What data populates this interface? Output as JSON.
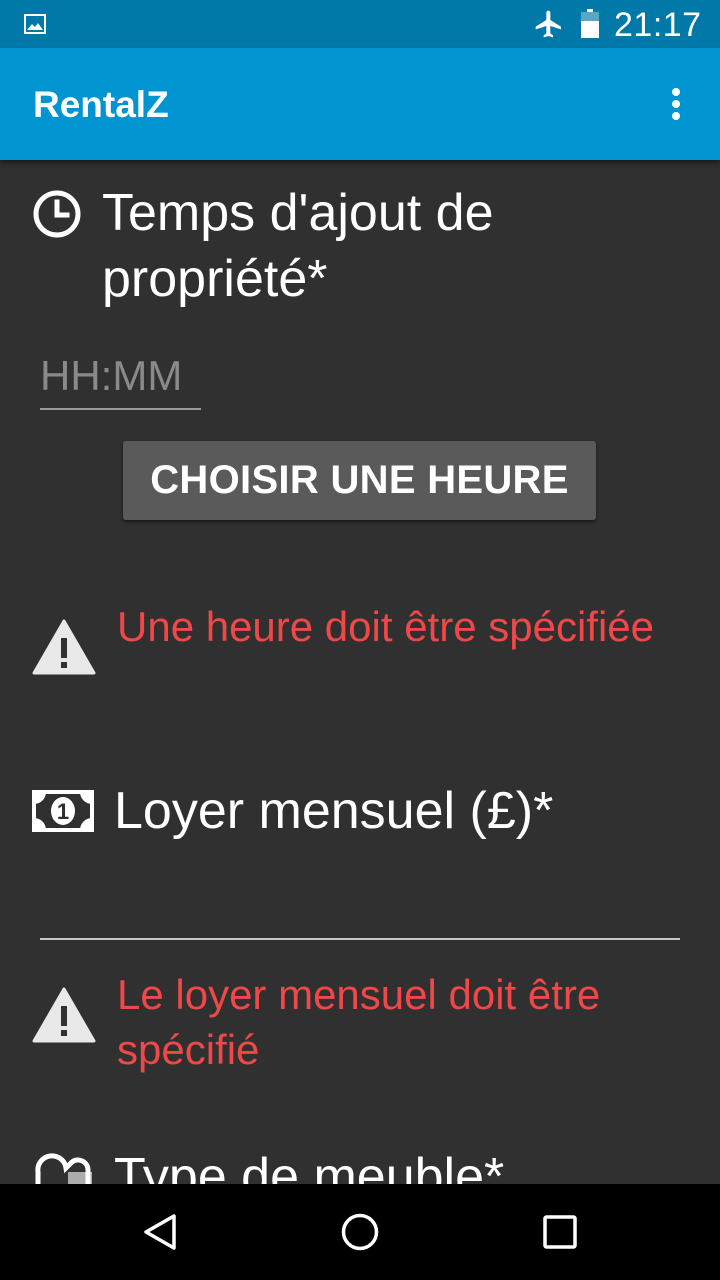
{
  "status_bar": {
    "time": "21:17",
    "icons": [
      "gallery-notification-icon",
      "airplane-mode-icon",
      "battery-icon"
    ]
  },
  "app_bar": {
    "title": "RentalZ",
    "menu_icon": "more-vert-icon"
  },
  "form": {
    "time_section": {
      "icon": "clock-icon",
      "title": "Temps d'ajout de propriété*",
      "input_placeholder": "HH:MM",
      "input_value": "",
      "button_label": "CHOISIR UNE HEURE",
      "error_icon": "warning-icon",
      "error": "Une heure doit être spécifiée"
    },
    "rent_section": {
      "icon": "money-icon",
      "title": "Loyer mensuel (£)*",
      "input_value": "",
      "error_icon": "warning-icon",
      "error": "Le loyer mensuel doit être spécifié"
    },
    "furniture_section": {
      "icon": "sofa-icon",
      "title": "Type de meuble*"
    }
  },
  "colors": {
    "status_bar": "#0079a8",
    "app_bar": "#0095d0",
    "background": "#303030",
    "error": "#f04848",
    "button": "#5a5a5a"
  },
  "nav_bar": {
    "buttons": [
      "back-icon",
      "home-icon",
      "recents-icon"
    ]
  }
}
